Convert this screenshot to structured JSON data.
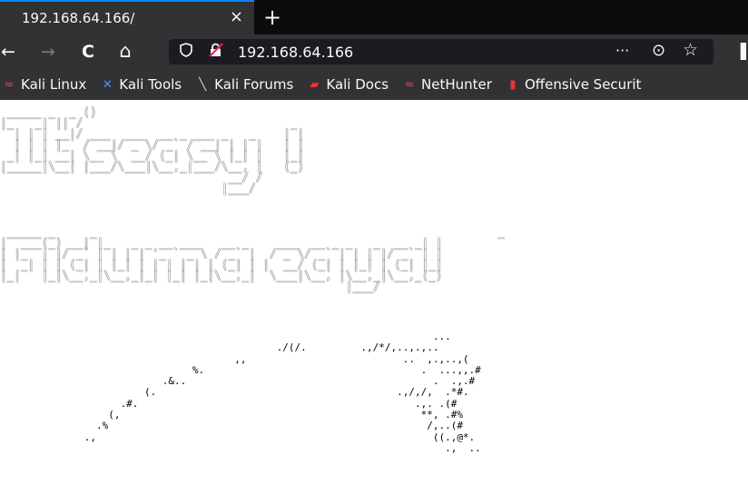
{
  "tab": {
    "title": "192.168.64.166/",
    "close_glyph": "×",
    "new_tab_glyph": "+"
  },
  "nav": {
    "back_glyph": "←",
    "forward_glyph": "→",
    "reload_glyph": "C",
    "home_glyph": "⌂",
    "url": "192.168.64.166",
    "more_glyph": "···",
    "pocket_glyph": "⊙",
    "star_glyph": "☆",
    "library_glyph": "▌"
  },
  "bookmarks": [
    {
      "label": "Kali Linux",
      "icon": "kali-dragon-icon",
      "glyph": "≈",
      "color": "#e44"
    },
    {
      "label": "Kali Tools",
      "icon": "kali-tools-icon",
      "glyph": "✕",
      "color": "#49f"
    },
    {
      "label": "Kali Forums",
      "icon": "kali-forums-icon",
      "glyph": "╲",
      "color": "#ddd"
    },
    {
      "label": "Kali Docs",
      "icon": "kali-docs-icon",
      "glyph": "▰",
      "color": "#e33"
    },
    {
      "label": "NetHunter",
      "icon": "nethunter-icon",
      "glyph": "≈",
      "color": "#e44"
    },
    {
      "label": "Offensive Securit",
      "icon": "offsec-icon",
      "glyph": "▮",
      "color": "#e33"
    }
  ],
  "page": {
    "art_line1": " _____ _  _ ()\n|_   _| || /                              _\n  | | | __|/ ___  ___  __ _ ___ _   _    | |\n  | | | |_  / __|/ _ \\/ _` / __| | | |   | |\n _| |_| __| \\__ \\  __/ (_| \\__ \\ |_| |   |_|\n|_____|\\__| |___/\\___|\\__,_|___/\\__, |   (_)\n                                 __/ /\n                                |___/",
    "art_line2": " _____ _     _                                                          _\n|  ___(_) __| |_   _ _ __ ___   __ _    ___  __ _ _   _  __ _| |\n| |_  | |/ _` | | | | '_ ` _ \\ / _` |  / _ \\/ _` | | | |/ _` | |\n|  _| | | (_| | |_| | | | | | | (_| | |  __/ (_| | |_| | (_| |_|\n|_|   |_|\\__,_|\\__,_|_| |_| |_|\\__,_|  \\___|\\__, |\\__,_|\\__,_(_)\n                                                  |___/",
    "skull_art": "                                                                        ...\n                                              ./(/.         .,/*/,..,.,..\n                                       ,,                          ..  ,.,..,(\n                                %.                                    .  ...,,.#\n                           .&..                                         .  .,.#\n                        (.                                        .,/,/,  .*#.\n                    .#.                                              .,. .(#\n                  (,                                                  **, .#%\n                .%                                                     /,..(#\n              .,                                                        ((.,@*.\n                                                                          .,  .."
  }
}
